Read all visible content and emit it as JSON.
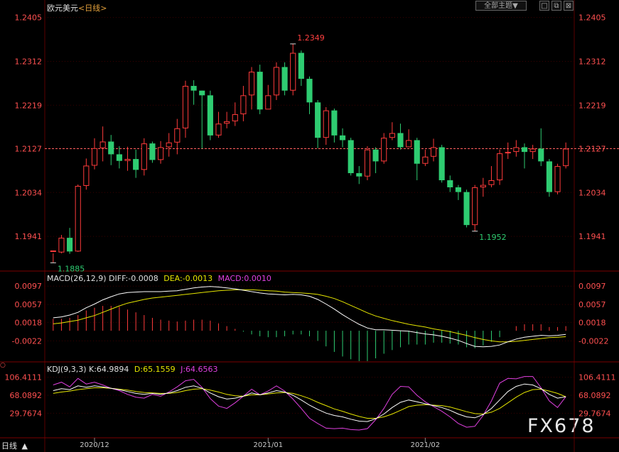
{
  "header": {
    "symbol": "欧元美元",
    "period_label": "<日线>",
    "theme_button": "全部主题▼",
    "icon_buttons": [
      "□",
      "⧉",
      "⊠"
    ]
  },
  "colors": {
    "up": "#ff3b3b",
    "down": "#2ecc71",
    "axis_label": "#ff5050",
    "macd_line": "#ffffff",
    "dea_line": "#e6e600",
    "kdj_k": "#ffffff",
    "kdj_d": "#e6e600",
    "kdj_j": "#e040e0",
    "grid": "#3a0000"
  },
  "chart_data": [
    {
      "type": "candlestick",
      "title": "欧元美元 <日线>",
      "yticks": [
        "1.2405",
        "1.2312",
        "1.2219",
        "1.2127",
        "1.2034",
        "1.1941"
      ],
      "ylim": [
        1.1878,
        1.2412
      ],
      "reference_line": 1.2127,
      "high_annotation": "1.2349",
      "low_annotation_1": "1.1885",
      "low_annotation_2": "1.1952",
      "candles": [
        [
          1.1908,
          1.1911,
          1.1905,
          1.1885
        ],
        [
          1.1907,
          1.1938,
          1.1944,
          1.1905
        ],
        [
          1.1938,
          1.1909,
          1.1959,
          1.1904
        ],
        [
          1.1909,
          1.2048,
          1.2051,
          1.1908
        ],
        [
          1.2048,
          1.2091,
          1.2106,
          1.204
        ],
        [
          1.2091,
          1.2128,
          1.2149,
          1.2083
        ],
        [
          1.2128,
          1.2142,
          1.2174,
          1.21
        ],
        [
          1.2142,
          1.2115,
          1.2156,
          1.2092
        ],
        [
          1.2115,
          1.2101,
          1.2132,
          1.2085
        ],
        [
          1.2101,
          1.2105,
          1.2131,
          1.208
        ],
        [
          1.2105,
          1.2082,
          1.2125,
          1.2065
        ],
        [
          1.2082,
          1.2138,
          1.2149,
          1.207
        ],
        [
          1.2138,
          1.2103,
          1.2142,
          1.2097
        ],
        [
          1.2103,
          1.213,
          1.2143,
          1.2095
        ],
        [
          1.213,
          1.214,
          1.216,
          1.211
        ],
        [
          1.214,
          1.217,
          1.219,
          1.2115
        ],
        [
          1.217,
          1.226,
          1.2271,
          1.215
        ],
        [
          1.226,
          1.225,
          1.2272,
          1.222
        ],
        [
          1.225,
          1.224,
          1.225,
          1.2127
        ],
        [
          1.224,
          1.2155,
          1.225,
          1.2145
        ],
        [
          1.2155,
          1.218,
          1.2205,
          1.215
        ],
        [
          1.218,
          1.2185,
          1.2205,
          1.217
        ],
        [
          1.2185,
          1.22,
          1.2225,
          1.2175
        ],
        [
          1.22,
          1.224,
          1.226,
          1.2185
        ],
        [
          1.224,
          1.229,
          1.23,
          1.221
        ],
        [
          1.229,
          1.221,
          1.2305,
          1.22
        ],
        [
          1.221,
          1.224,
          1.2262,
          1.2215
        ],
        [
          1.224,
          1.23,
          1.231,
          1.223
        ],
        [
          1.23,
          1.225,
          1.231,
          1.224
        ],
        [
          1.225,
          1.233,
          1.2349,
          1.224
        ],
        [
          1.233,
          1.2275,
          1.2335,
          1.226
        ],
        [
          1.2275,
          1.2225,
          1.228,
          1.22
        ],
        [
          1.2225,
          1.215,
          1.223,
          1.2128
        ],
        [
          1.215,
          1.2208,
          1.2215,
          1.2135
        ],
        [
          1.2208,
          1.2155,
          1.2212,
          1.214
        ],
        [
          1.2155,
          1.2145,
          1.217,
          1.213
        ],
        [
          1.2145,
          1.2075,
          1.215,
          1.207
        ],
        [
          1.2075,
          1.2068,
          1.209,
          1.2052
        ],
        [
          1.2068,
          1.2125,
          1.2132,
          1.206
        ],
        [
          1.2125,
          1.21,
          1.213,
          1.2075
        ],
        [
          1.21,
          1.215,
          1.216,
          1.2095
        ],
        [
          1.215,
          1.216,
          1.2183,
          1.2145
        ],
        [
          1.216,
          1.213,
          1.218,
          1.2125
        ],
        [
          1.213,
          1.2145,
          1.2168,
          1.213
        ],
        [
          1.2145,
          1.2095,
          1.215,
          1.206
        ],
        [
          1.2095,
          1.211,
          1.2125,
          1.209
        ],
        [
          1.211,
          1.213,
          1.2148,
          1.21
        ],
        [
          1.213,
          1.206,
          1.2135,
          1.2055
        ],
        [
          1.206,
          1.2045,
          1.207,
          1.2035
        ],
        [
          1.2045,
          1.2035,
          1.205,
          1.2018
        ],
        [
          1.2035,
          1.1965,
          1.204,
          1.196
        ],
        [
          1.1965,
          1.2045,
          1.205,
          1.1952
        ],
        [
          1.2045,
          1.205,
          1.2065,
          1.2025
        ],
        [
          1.205,
          1.206,
          1.209,
          1.2045
        ],
        [
          1.206,
          1.2117,
          1.2125,
          1.205
        ],
        [
          1.2117,
          1.212,
          1.214,
          1.2105
        ],
        [
          1.212,
          1.213,
          1.2145,
          1.211
        ],
        [
          1.213,
          1.212,
          1.2138,
          1.2085
        ],
        [
          1.212,
          1.2127,
          1.2135,
          1.2105
        ],
        [
          1.2127,
          1.21,
          1.217,
          1.209
        ],
        [
          1.21,
          1.2035,
          1.2105,
          1.2025
        ],
        [
          1.2035,
          1.209,
          1.2095,
          1.203
        ],
        [
          1.209,
          1.2127,
          1.214,
          1.2085
        ]
      ],
      "xticks": [
        {
          "label": "2020/12",
          "index": 5
        },
        {
          "label": "2021/01",
          "index": 26
        },
        {
          "label": "2021/02",
          "index": 45
        }
      ]
    },
    {
      "type": "macd",
      "params": "MACD(26,12,9)",
      "diff_label": "DIFF:-0.0008",
      "dea_label": "DEA:-0.0013",
      "macd_label": "MACD:0.0010",
      "yticks": [
        "0.0097",
        "0.0057",
        "0.0018",
        "-0.0022"
      ],
      "ylim": [
        -0.006,
        0.0105
      ],
      "diff": [
        0.0028,
        0.003,
        0.0034,
        0.004,
        0.005,
        0.0058,
        0.0067,
        0.0074,
        0.008,
        0.0083,
        0.0084,
        0.0085,
        0.0085,
        0.0085,
        0.0086,
        0.0087,
        0.009,
        0.0093,
        0.0095,
        0.0096,
        0.0095,
        0.0093,
        0.0091,
        0.0088,
        0.0085,
        0.0082,
        0.008,
        0.0079,
        0.0078,
        0.0079,
        0.0078,
        0.0075,
        0.0068,
        0.0058,
        0.0047,
        0.0035,
        0.0024,
        0.0014,
        0.0006,
        0.0002,
        0.0002,
        0.0001,
        0.0,
        -0.0001,
        -0.0004,
        -0.0007,
        -0.0009,
        -0.0012,
        -0.0016,
        -0.0021,
        -0.0028,
        -0.0034,
        -0.0035,
        -0.0034,
        -0.0031,
        -0.0024,
        -0.0018,
        -0.0014,
        -0.0012,
        -0.001,
        -0.0011,
        -0.001,
        -0.0008
      ],
      "dea": [
        0.0015,
        0.0017,
        0.002,
        0.0023,
        0.0028,
        0.0033,
        0.004,
        0.0047,
        0.0054,
        0.006,
        0.0064,
        0.0068,
        0.0071,
        0.0073,
        0.0075,
        0.0077,
        0.0079,
        0.0081,
        0.0083,
        0.0085,
        0.0087,
        0.0088,
        0.0089,
        0.0089,
        0.0089,
        0.0088,
        0.0087,
        0.0086,
        0.0084,
        0.0083,
        0.0082,
        0.0081,
        0.0079,
        0.0075,
        0.007,
        0.0063,
        0.0055,
        0.0047,
        0.0039,
        0.0032,
        0.0027,
        0.0022,
        0.0018,
        0.0014,
        0.0011,
        0.0008,
        0.0004,
        0.0001,
        -0.0002,
        -0.0006,
        -0.001,
        -0.0015,
        -0.0019,
        -0.0022,
        -0.0024,
        -0.0024,
        -0.0023,
        -0.0021,
        -0.0019,
        -0.0017,
        -0.0015,
        -0.0014,
        -0.0013
      ]
    },
    {
      "type": "kdj",
      "params": "KDJ(9,3,3)",
      "k_label": "K:64.9894",
      "d_label": "D:65.1559",
      "j_label": "J:64.6563",
      "yticks": [
        "106.4111",
        "68.0892",
        "29.7674"
      ],
      "ylim": [
        -15,
        118
      ],
      "k": [
        78,
        82,
        80,
        88,
        85,
        88,
        86,
        83,
        80,
        76,
        72,
        70,
        72,
        70,
        73,
        78,
        85,
        88,
        83,
        73,
        65,
        60,
        62,
        66,
        73,
        69,
        73,
        78,
        75,
        68,
        58,
        47,
        38,
        30,
        25,
        22,
        17,
        13,
        12,
        18,
        28,
        42,
        53,
        58,
        54,
        50,
        46,
        42,
        36,
        28,
        22,
        20,
        27,
        40,
        58,
        76,
        87,
        92,
        90,
        82,
        70,
        62,
        65
      ],
      "d": [
        72,
        75,
        77,
        80,
        82,
        84,
        84,
        83,
        81,
        79,
        76,
        74,
        73,
        72,
        72,
        74,
        78,
        81,
        82,
        79,
        75,
        70,
        67,
        66,
        69,
        69,
        71,
        73,
        74,
        72,
        67,
        61,
        53,
        46,
        39,
        34,
        28,
        23,
        19,
        19,
        22,
        28,
        36,
        44,
        47,
        48,
        47,
        46,
        43,
        38,
        33,
        29,
        28,
        32,
        40,
        52,
        64,
        74,
        80,
        81,
        77,
        72,
        65
      ],
      "j": [
        90,
        96,
        86,
        104,
        92,
        96,
        90,
        83,
        78,
        70,
        64,
        62,
        70,
        66,
        75,
        86,
        99,
        102,
        85,
        61,
        45,
        40,
        52,
        66,
        81,
        69,
        77,
        88,
        77,
        60,
        40,
        19,
        8,
        -2,
        -3,
        -2,
        -5,
        -6,
        -3,
        16,
        40,
        70,
        87,
        86,
        68,
        54,
        44,
        34,
        22,
        8,
        0,
        2,
        25,
        56,
        94,
        104,
        103,
        108,
        108,
        84,
        56,
        42,
        65
      ]
    }
  ],
  "footer": {
    "period": "日线",
    "arrow": "▲",
    "watermark": "FX678",
    "corner_icon": "○"
  }
}
